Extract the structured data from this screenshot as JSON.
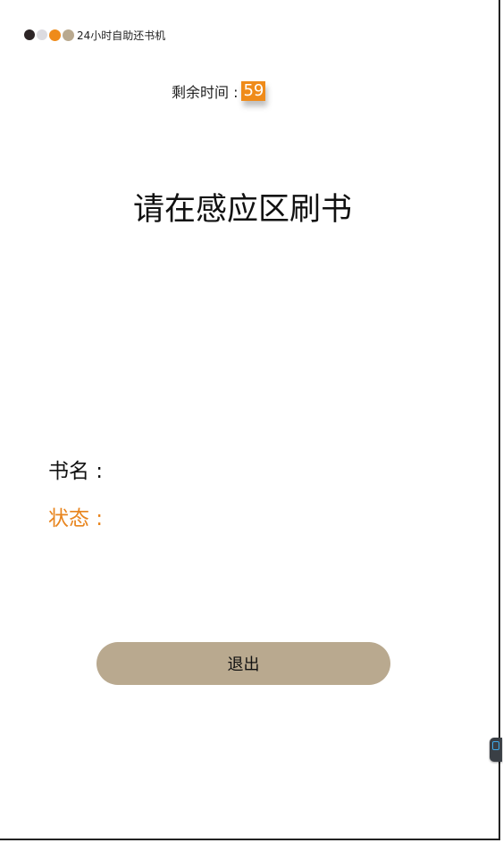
{
  "header": {
    "dots": [
      "#2d2526",
      "#dcdbe0",
      "#ef8b1a",
      "#b9a98f"
    ],
    "title": "24小时自助还书机"
  },
  "timer": {
    "label": "剩余时间 :",
    "value": "59",
    "accent_color": "#ef8b1a"
  },
  "prompt": {
    "text": "请在感应区刷书"
  },
  "info": {
    "book_name_label": "书名 :",
    "status_label": "状态 :",
    "status_color": "#e8851e"
  },
  "actions": {
    "exit_label": "退出",
    "button_color": "#b9a98f"
  },
  "side_widget": {
    "icon": "floating-tool-icon"
  }
}
